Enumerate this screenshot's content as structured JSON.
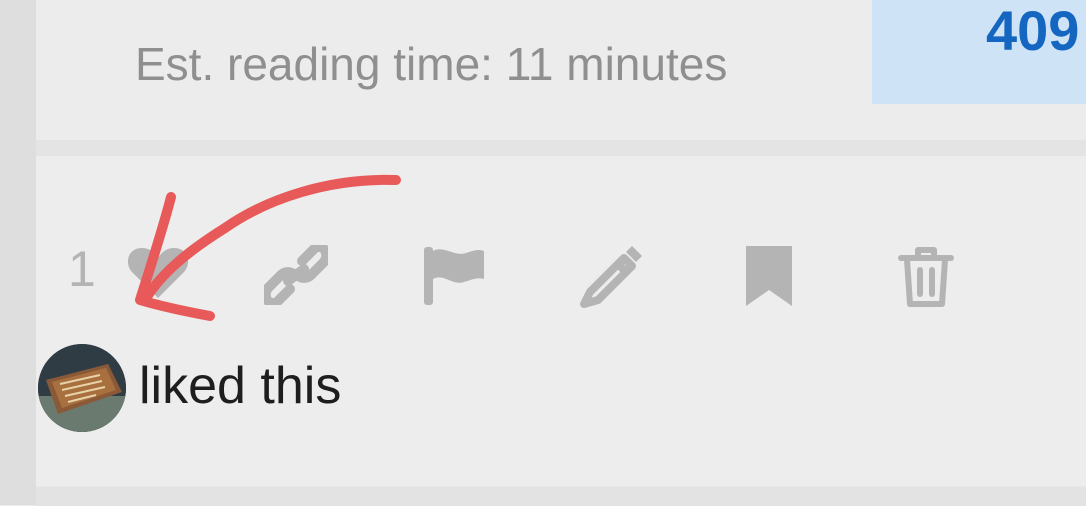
{
  "summary": {
    "reading_time": "Est. reading time: 11 minutes",
    "stat_value": "409"
  },
  "post_actions": {
    "like_count": "1",
    "icons": [
      "heart-icon",
      "link-icon",
      "flag-icon",
      "pencil-icon",
      "bookmark-icon",
      "trash-icon"
    ]
  },
  "likers": {
    "text": "liked this"
  },
  "colors": {
    "background": "#ebebeb",
    "stat_bg": "#cfe3f7",
    "stat_text": "#1466c0",
    "icon_gray": "#b4b4b4",
    "annotation_red": "#e85a5a"
  }
}
